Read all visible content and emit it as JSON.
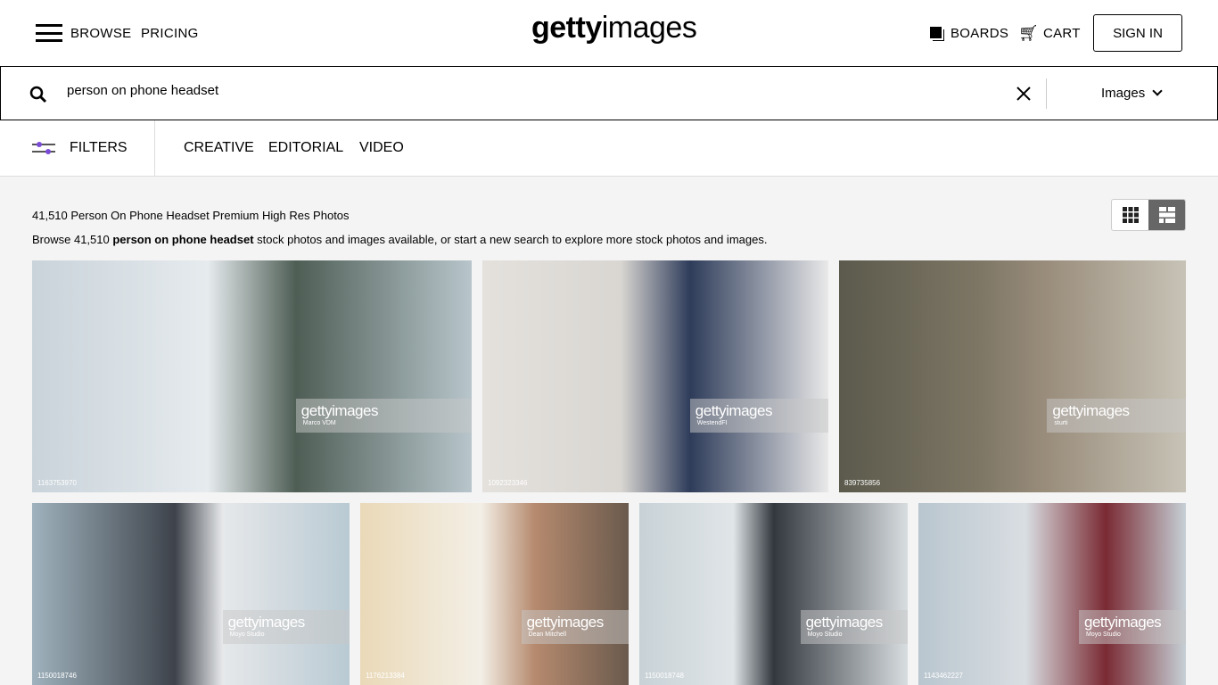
{
  "header": {
    "browse": "BROWSE",
    "pricing": "PRICING",
    "logo_bold": "getty",
    "logo_light": "images",
    "boards": "BOARDS",
    "cart": "CART",
    "sign_in": "SIGN IN"
  },
  "search": {
    "value": "person on phone headset",
    "type": "Images"
  },
  "filters": {
    "label": "FILTERS",
    "tabs": [
      "CREATIVE",
      "EDITORIAL",
      "VIDEO"
    ]
  },
  "results": {
    "count_line": "41,510 Person On Phone Headset Premium High Res Photos",
    "desc_pre": "Browse 41,510 ",
    "desc_bold": "person on phone headset",
    "desc_post": " stock photos and images available, or start a new search to explore more stock photos and images."
  },
  "images": [
    {
      "id": "1163753970",
      "credit": "Marco VDM",
      "bg": "linear-gradient(90deg,#c9d3da,#e6ebee 40%,#4e5e55 60%,#b8c6cc)"
    },
    {
      "id": "1092323346",
      "credit": "WestendFI",
      "bg": "linear-gradient(90deg,#e4e1dd,#d9d6d2 40%,#2e3c5a 60%,#e9e9e9)"
    },
    {
      "id": "839735856",
      "credit": "sturti",
      "bg": "linear-gradient(90deg,#5b5a4c,#7d7665 40%,#9a8d7c 60%,#c7c3b6)"
    },
    {
      "id": "1150018746",
      "credit": "Moyo Studio",
      "bg": "linear-gradient(90deg,#9fb2bd,#3e434b 45%,#e6e8ea 60%,#b9cad3)"
    },
    {
      "id": "1176213384",
      "credit": "Dean Mitchell",
      "bg": "linear-gradient(90deg,#ead9b8,#f3efe6 45%,#b68a6e 65%,#6a5a4d)"
    },
    {
      "id": "1150018748",
      "credit": "Moyo Studio",
      "bg": "linear-gradient(90deg,#c8d2d6,#e0e5e8 35%,#33383f 50%,#d8dde0)"
    },
    {
      "id": "1143462227",
      "credit": "Moyo Studio",
      "bg": "linear-gradient(90deg,#b9c6cf,#d9dee2 40%,#7a2a33 70%,#c6d0d6)"
    }
  ],
  "watermark": "gettyimages"
}
